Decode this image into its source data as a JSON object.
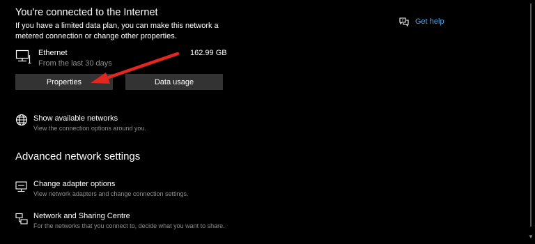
{
  "status": {
    "title": "You're connected to the Internet",
    "description": "If you have a limited data plan, you can make this network a metered connection or change other properties."
  },
  "connection": {
    "name": "Ethernet",
    "subtitle": "From the last 30 days",
    "usage": "162.99 GB"
  },
  "buttons": {
    "properties": "Properties",
    "data_usage": "Data usage"
  },
  "available_networks": {
    "title": "Show available networks",
    "subtitle": "View the connection options around you."
  },
  "advanced": {
    "heading": "Advanced network settings",
    "items": [
      {
        "title": "Change adapter options",
        "subtitle": "View network adapters and change connection settings."
      },
      {
        "title": "Network and Sharing Centre",
        "subtitle": "For the networks that you connect to, decide what you want to share."
      }
    ]
  },
  "help": {
    "label": "Get help"
  },
  "colors": {
    "background": "#000000",
    "button": "#333333",
    "link": "#4ea6ea",
    "secondary_text": "#8f8f8f",
    "arrow": "#e3261f"
  }
}
